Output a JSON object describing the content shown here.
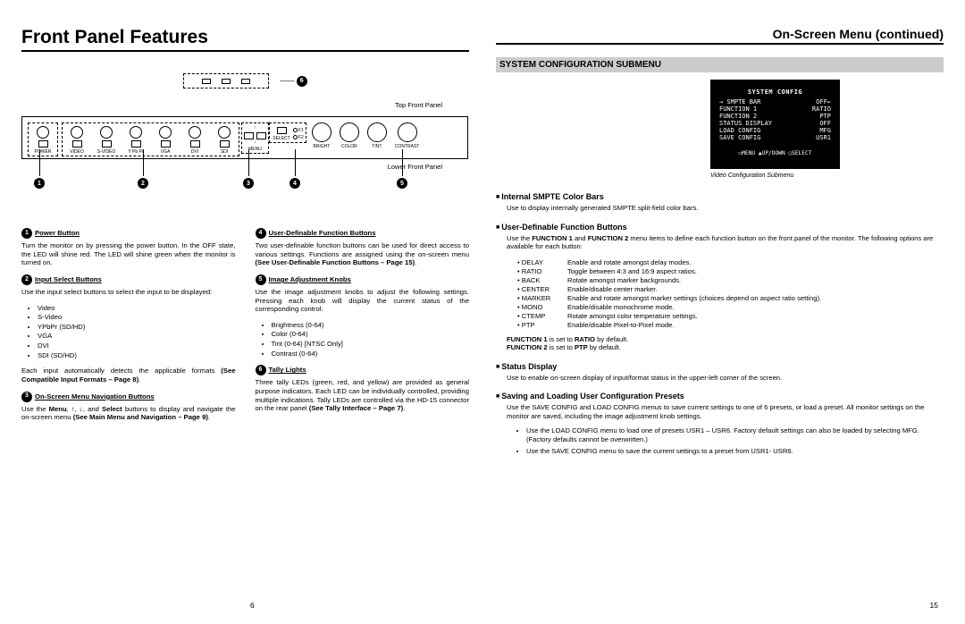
{
  "left": {
    "title": "Front Panel Features",
    "topCaption": "Top Front Panel",
    "lowerCaption": "Lower Front Panel",
    "panelLabels": {
      "power": "POWER",
      "video": "VIDEO",
      "svideo": "S-VIDEO",
      "ypbpr": "Y Pb Pr",
      "vga": "VGA",
      "dvi": "DVI",
      "sdi": "SDI",
      "menu": "MENU",
      "select": "SELECT",
      "f1": "F1",
      "f2": "F2",
      "bright": "BRIGHT",
      "color": "COLOR",
      "tint": "TINT",
      "contrast": "CONTRAST"
    },
    "desc": {
      "d1h": "Power Button",
      "d1p": "Turn the monitor on by pressing the power button. In the OFF state, the LED will shine red. The LED will shine green when the monitor is turned on.",
      "d2h": "Input Select Buttons",
      "d2p": "Use the input select buttons to select the input to be displayed:",
      "d2list": [
        "Video",
        "S-Video",
        "YPbPr (SD/HD)",
        "VGA",
        "DVI",
        "SDI (SD/HD)"
      ],
      "d2p2a": "Each input automatically detects the applicable formats ",
      "d2p2b": "(See Compatible Input Formats – Page 8)",
      "d3h": "On-Screen Menu Navigation Buttons",
      "d3pa": "Use the ",
      "d3pb": "Menu",
      "d3pc": ", ↑, ↓, and ",
      "d3pd": "Select",
      "d3pe": " buttons to display and navigate the on-screen menu ",
      "d3pf": "(See Main Menu and Navigation – Page 9)",
      "d4h": "User-Definable Function Buttons",
      "d4pa": "Two user-definable function buttons can be used for direct access to various settings. Functions are assigned using the on-screen menu ",
      "d4pb": "(See User-Definable Function Buttons – Page 15)",
      "d5h": "Image Adjustment Knobs",
      "d5p": "Use the image adjustment knobs to adjust the following settings. Pressing each knob will display the current status of the corresponding control:",
      "d5list": [
        "Brightness (0-64)",
        "Color (0-64)",
        "Tint (0-64) [NTSC Only]",
        "Contrast (0-64)"
      ],
      "d6h": "Tally Lights",
      "d6pa": "Three tally LEDs (green, red, and yellow) are provided as general purpose indicators. Each LED can be individually controlled, providing multiple indications. Tally LEDs are controlled via the HD-15 connector on the rear panel ",
      "d6pb": "(See Tally Interface – Page 7)"
    },
    "pageNum": "6"
  },
  "right": {
    "title": "On-Screen Menu (continued)",
    "sectionBar": "SYSTEM CONFIGURATION SUBMENU",
    "screen": {
      "title": "SYSTEM CONFIG",
      "rows": [
        [
          "→ SMPTE BAR",
          "OFF←"
        ],
        [
          "FUNCTION 1",
          "RATIO"
        ],
        [
          "FUNCTION 2",
          "PTP"
        ],
        [
          "STATUS DISPLAY",
          "OFF"
        ],
        [
          "LOAD CONFIG",
          "MFG"
        ],
        [
          "SAVE CONFIG",
          "USR1"
        ]
      ],
      "footer": "▭MENU ▲UP/DOWN ◯SELECT"
    },
    "screenCaption": "Video Configuration Submenu",
    "s1h": "Internal SMPTE Color Bars",
    "s1p": "Use to display internally generated SMPTE split-field color bars.",
    "s2h": "User-Definable Function Buttons",
    "s2pa": "Use the ",
    "s2pbold1": "FUNCTION 1",
    "s2pb": " and ",
    "s2pbold2": "FUNCTION 2",
    "s2pc": " menu items to define each function button on the front panel of the monitor. The following options are available for each button:",
    "opts": [
      [
        "DELAY",
        "Enable and rotate amongst delay modes."
      ],
      [
        "RATIO",
        "Toggle between 4:3 and 16:9 aspect ratios."
      ],
      [
        "BACK",
        "Rotate amongst marker backgrounds."
      ],
      [
        "CENTER",
        "Enable/disable center marker."
      ],
      [
        "MARKER",
        "Enable and rotate amongst marker settings (choices depend on aspect ratio setting)."
      ],
      [
        "MONO",
        "Enable/disable monochrome mode."
      ],
      [
        "CTEMP",
        "Rotate amongst color temperature settings."
      ],
      [
        "PTP",
        "Enable/disable Pixel-to-Pixel mode."
      ]
    ],
    "s2fa": "FUNCTION 1",
    "s2fb": " is set to ",
    "s2fc": "RATIO",
    "s2fd": " by default.",
    "s2ga": "FUNCTION 2",
    "s2gb": " is set to ",
    "s2gc": "PTP",
    "s2gd": " by default.",
    "s3h": "Status Display",
    "s3p": "Use to enable on-screen display of input/format status in the upper-left corner of the screen.",
    "s4h": "Saving and Loading User Configuration Presets",
    "s4p": "Use the SAVE CONFIG and LOAD CONFIG menus to save current settings to one of 6 presets, or load a preset.  All monitor settings on the monitor are saved, including the image adjustment knob settings.",
    "s4b1": "Use the LOAD CONFIG menu to load one of presets USR1 – USR6. Factory default settings can also be loaded by selecting MFG. (Factory defaults cannot be overwritten.)",
    "s4b2": "Use the SAVE CONFIG menu to save the current settings to a preset from USR1- USR6.",
    "pageNum": "15"
  }
}
